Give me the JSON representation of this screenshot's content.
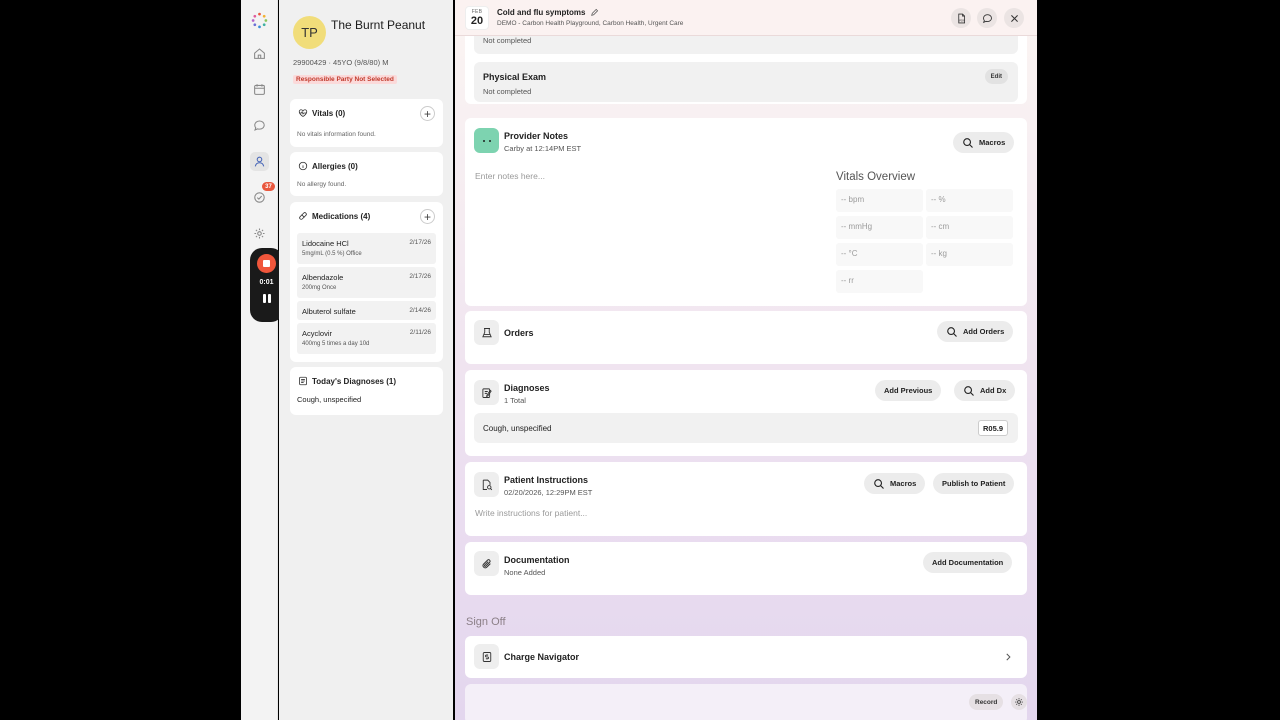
{
  "rail": {
    "tasks_badge": "37",
    "recording_time": "0:01",
    "accent_color": "#f0563b"
  },
  "patient": {
    "initials": "TP",
    "name": "The Burnt Peanut",
    "meta": "29900429 · 45YO (9/8/80) M",
    "responsible_party": "Responsible Party Not Selected",
    "vitals": {
      "title": "Vitals (0)",
      "empty": "No vitals information found."
    },
    "allergies": {
      "title": "Allergies (0)",
      "empty": "No allergy found."
    },
    "medications": {
      "title": "Medications (4)",
      "items": [
        {
          "name": "Lidocaine HCl",
          "sig": "5mg/mL (0.5 %) Office",
          "date": "2/17/26"
        },
        {
          "name": "Albendazole",
          "sig": "200mg Once",
          "date": "2/17/26"
        },
        {
          "name": "Albuterol sulfate",
          "sig": "",
          "date": "2/14/26"
        },
        {
          "name": "Acyclovir",
          "sig": "400mg 5 times a day 10d",
          "date": "2/11/26"
        }
      ]
    },
    "diagnoses": {
      "title": "Today's Diagnoses (1)",
      "items": [
        "Cough, unspecified"
      ]
    }
  },
  "visit": {
    "month": "FEB",
    "day": "20",
    "title": "Cold and flu symptoms",
    "subtitle": "DEMO - Carbon Health Playground, Carbon Health, Urgent Care"
  },
  "exam": {
    "prev_status": "Not completed",
    "title": "Physical Exam",
    "status": "Not completed",
    "edit_label": "Edit"
  },
  "provider_notes": {
    "title": "Provider Notes",
    "subtitle": "Carby at 12:14PM EST",
    "macros_label": "Macros",
    "placeholder": "Enter notes here...",
    "vitals_title": "Vitals Overview",
    "vitals": [
      "-- bpm",
      "-- %",
      "-- mmHg",
      "-- cm",
      "-- °C",
      "-- kg",
      "-- rr"
    ]
  },
  "orders": {
    "title": "Orders",
    "add_label": "Add Orders"
  },
  "diagnoses": {
    "title": "Diagnoses",
    "subtitle": "1 Total",
    "add_previous_label": "Add Previous",
    "add_dx_label": "Add Dx",
    "items": [
      {
        "name": "Cough, unspecified",
        "code": "R05.9"
      }
    ]
  },
  "instructions": {
    "title": "Patient Instructions",
    "subtitle": "02/20/2026, 12:29PM EST",
    "macros_label": "Macros",
    "publish_label": "Publish to Patient",
    "placeholder": "Write instructions for patient..."
  },
  "documentation": {
    "title": "Documentation",
    "subtitle": "None Added",
    "add_label": "Add Documentation"
  },
  "signoff": {
    "label": "Sign Off",
    "charge_navigator": "Charge Navigator"
  },
  "footer": {
    "record_label": "Record"
  }
}
